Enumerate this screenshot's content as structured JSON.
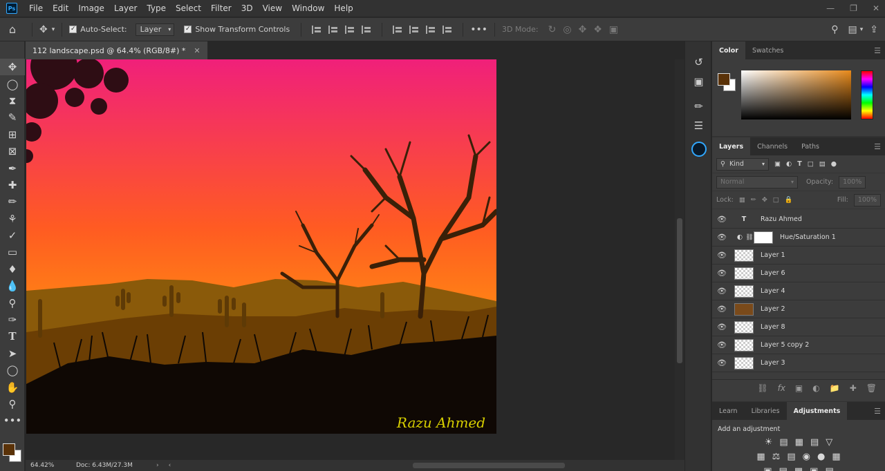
{
  "app": {
    "logo": "Ps"
  },
  "menu": [
    "File",
    "Edit",
    "Image",
    "Layer",
    "Type",
    "Select",
    "Filter",
    "3D",
    "View",
    "Window",
    "Help"
  ],
  "options": {
    "auto_select_label": "Auto-Select:",
    "auto_select_value": "Layer",
    "transform_label": "Show Transform Controls",
    "mode_3d_label": "3D Mode:"
  },
  "document": {
    "tab_title": "112 landscape.psd @ 64.4% (RGB/8#) *",
    "watermark": "Razu Ahmed"
  },
  "status": {
    "zoom": "64.42%",
    "doc_info": "Doc: 6.43M/27.3M"
  },
  "panels": {
    "color_tabs": [
      "Color",
      "Swatches"
    ],
    "layers_tabs": [
      "Layers",
      "Channels",
      "Paths"
    ],
    "kind_label": "Kind",
    "blend_mode": "Normal",
    "opacity_label": "Opacity:",
    "opacity_value": "100%",
    "lock_label": "Lock:",
    "fill_label": "Fill:",
    "fill_value": "100%",
    "layers": [
      "Razu Ahmed",
      "Hue/Saturation 1",
      "Layer 1",
      "Layer 6",
      "Layer 4",
      "Layer 2",
      "Layer 8",
      "Layer 5 copy 2",
      "Layer 3"
    ],
    "bottom_tabs": [
      "Learn",
      "Libraries",
      "Adjustments"
    ],
    "adjustment_hint": "Add an adjustment"
  },
  "colors": {
    "foreground": "#5a3208",
    "background": "#ffffff",
    "sky_top": "#f0207a",
    "sky_bottom": "#ffc000"
  }
}
